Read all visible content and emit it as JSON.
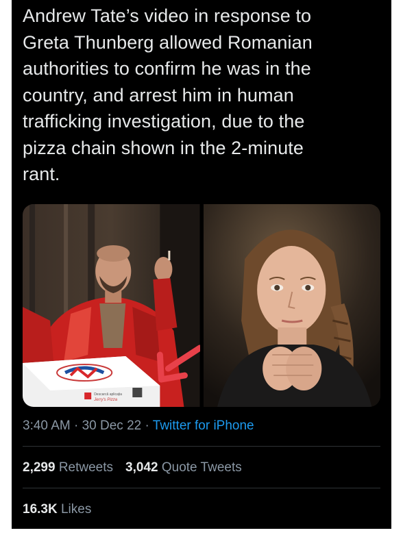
{
  "tweet": {
    "text": "Andrew Tate’s video in response to\nGreta Thunberg allowed Romanian\nauthorities to confirm he was in the\ncountry, and arrest him in human\ntrafficking investigation, due to the\npizza chain shown in the 2-minute\nrant.",
    "time": "3:40 AM",
    "date": "30 Dec 22",
    "separator": "·",
    "source": "Twitter for iPhone",
    "retweets_count": "2,299",
    "retweets_label": "Retweets",
    "quotes_count": "3,042",
    "quotes_label": "Quote Tweets",
    "likes_count": "16.3K",
    "likes_label": "Likes"
  },
  "media": {
    "left_photo": {
      "pizza_box_text_line1": "Descarcă aplicația",
      "pizza_box_text_line2": "Jerry's Pizza"
    },
    "right_photo": {}
  },
  "colors": {
    "background": "#000000",
    "text": "#e7e9ea",
    "secondary": "#8b98a5",
    "link": "#1d9bf0",
    "divider": "#2f3336"
  }
}
